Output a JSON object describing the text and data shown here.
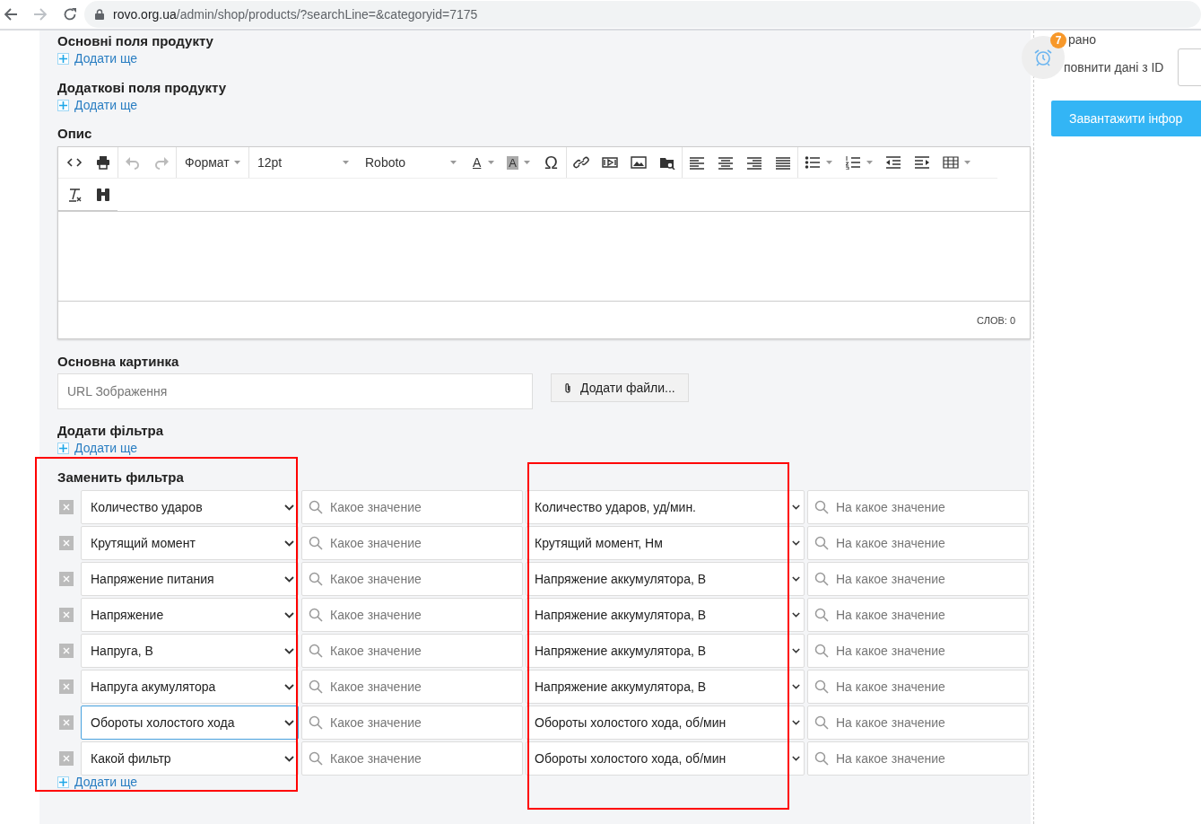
{
  "browser": {
    "url_host": "rovo.org.ua",
    "url_path": "/admin/shop/products/?searchLine=&categoryid=7175"
  },
  "sections_top": [
    {
      "title": "Основні поля продукту",
      "add_link": "Додати ще"
    },
    {
      "title": "Додаткові поля продукту",
      "add_link": "Додати ще"
    }
  ],
  "description": {
    "title": "Опис",
    "toolbar": {
      "format": "Формат",
      "font_size": "12pt",
      "font": "Roboto",
      "text_color": "A",
      "highlight_color": "A",
      "symbol": "Ω"
    },
    "word_count": "СЛОВ: 0"
  },
  "main_image": {
    "title": "Основна картинка",
    "placeholder": "URL Зображення",
    "button": "Додати файли..."
  },
  "add_filter": {
    "title": "Додати фільтра",
    "add_link": "Додати ще"
  },
  "replace_filters": {
    "title": "Заменить фильтра",
    "highlight": {
      "source": true,
      "target": true
    },
    "rows": [
      {
        "source": "Количество ударов",
        "focused": false,
        "source_placeholder": "Какое значение",
        "target": "Количество ударов, уд/мин.",
        "target_placeholder": "На какое значение"
      },
      {
        "source": "Крутящий момент",
        "focused": false,
        "source_placeholder": "Какое значение",
        "target": "Крутящий момент, Нм",
        "target_placeholder": "На какое значение"
      },
      {
        "source": "Напряжение питания",
        "focused": false,
        "source_placeholder": "Какое значение",
        "target": "Напряжение аккумулятора, В",
        "target_placeholder": "На какое значение"
      },
      {
        "source": "Напряжение",
        "focused": false,
        "source_placeholder": "Какое значение",
        "target": "Напряжение аккумулятора, В",
        "target_placeholder": "На какое значение"
      },
      {
        "source": "Напруга, В",
        "focused": false,
        "source_placeholder": "Какое значение",
        "target": "Напряжение аккумулятора, В",
        "target_placeholder": "На какое значение"
      },
      {
        "source": "Напруга акумулятора",
        "focused": false,
        "source_placeholder": "Какое значение",
        "target": "Напряжение аккумулятора, В",
        "target_placeholder": "На какое значение"
      },
      {
        "source": "Обороты холостого хода",
        "focused": true,
        "source_placeholder": "Какое значение",
        "target": "Обороты холостого хода, об/мин",
        "target_placeholder": "На какое значение"
      },
      {
        "source": "Какой фильтр",
        "focused": false,
        "source_placeholder": "Какое значение",
        "target": "Обороты холостого хода, об/мин",
        "target_placeholder": "На какое значение"
      }
    ],
    "add_link": "Додати ще"
  },
  "side": {
    "top_text": "рано",
    "fill_label": "повнити дані з ID",
    "button": "Завантажити інфор",
    "reminder_count": "7"
  }
}
